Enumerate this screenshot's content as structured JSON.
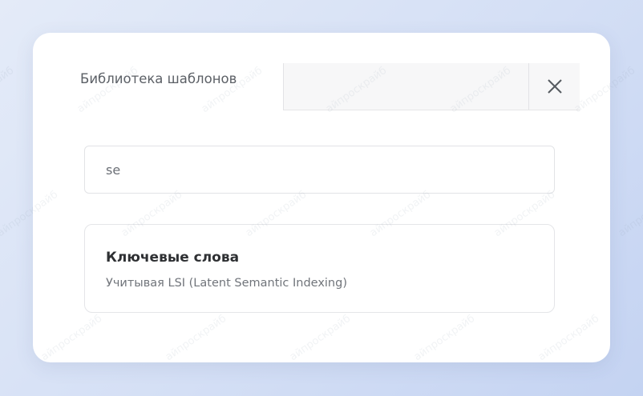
{
  "modal": {
    "title": "Библиотека шаблонов",
    "close_icon": "close-icon"
  },
  "search": {
    "value": "se"
  },
  "results": [
    {
      "title": "Ключевые слова",
      "description": "Учитывая LSI (Latent Semantic Indexing)"
    }
  ],
  "watermark": "айпроскрайб",
  "colors": {
    "background": "#d4dff5",
    "modal": "#ffffff",
    "header_bar": "#f7f7f8",
    "title_text": "#5c6066",
    "card_title": "#2e3033",
    "card_desc": "#70747a"
  }
}
